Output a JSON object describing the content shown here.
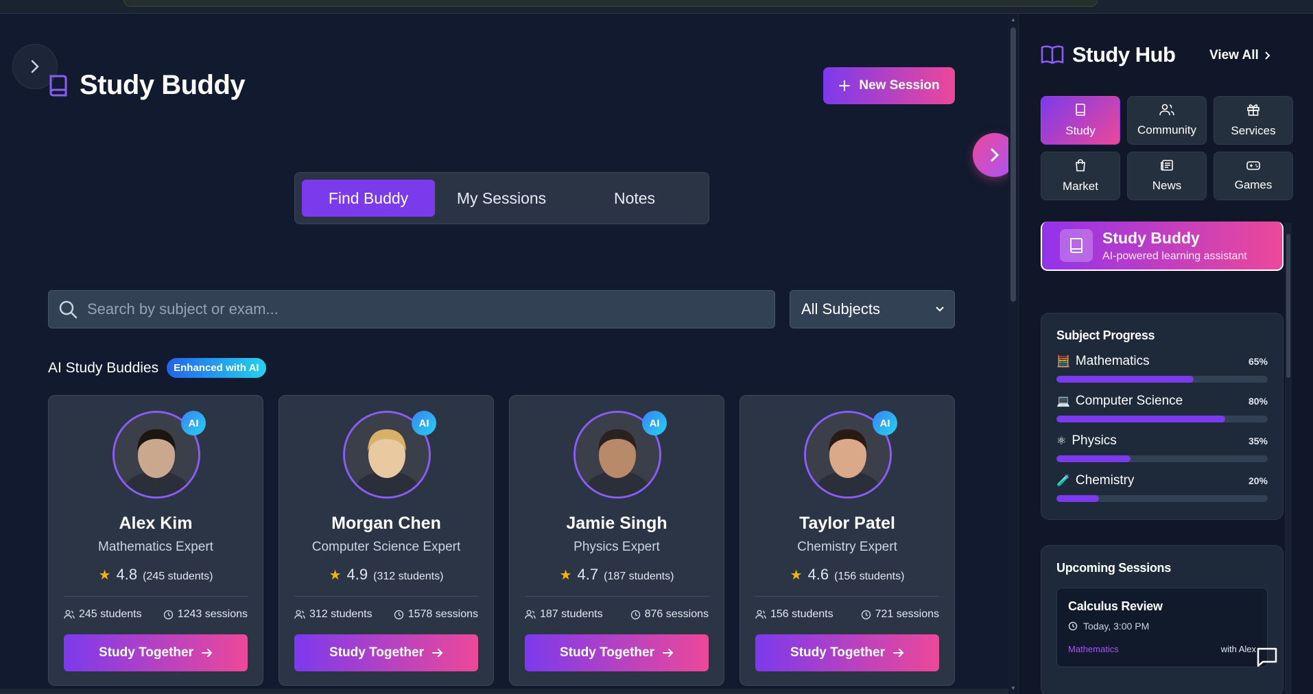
{
  "app": {
    "title": "Study Buddy",
    "new_session_label": "New Session"
  },
  "tabs": [
    {
      "label": "Find Buddy",
      "active": true
    },
    {
      "label": "My Sessions",
      "active": false
    },
    {
      "label": "Notes",
      "active": false
    }
  ],
  "search": {
    "placeholder": "Search by subject or exam...",
    "value": ""
  },
  "filter": {
    "selected": "All Subjects"
  },
  "section": {
    "title": "AI Study Buddies",
    "badge": "Enhanced with AI"
  },
  "buddies": [
    {
      "name": "Alex Kim",
      "role": "Mathematics Expert",
      "rating": "4.8",
      "rating_count": "(245 students)",
      "students": "245 students",
      "sessions": "1243 sessions",
      "ai": "AI",
      "cta": "Study Together",
      "avatar_bg": "#c9a88e",
      "hair": "#1c1510"
    },
    {
      "name": "Morgan Chen",
      "role": "Computer Science Expert",
      "rating": "4.9",
      "rating_count": "(312 students)",
      "students": "312 students",
      "sessions": "1578 sessions",
      "ai": "AI",
      "cta": "Study Together",
      "avatar_bg": "#e8c9a0",
      "hair": "#d8b068"
    },
    {
      "name": "Jamie Singh",
      "role": "Physics Expert",
      "rating": "4.7",
      "rating_count": "(187 students)",
      "students": "187 students",
      "sessions": "876 sessions",
      "ai": "AI",
      "cta": "Study Together",
      "avatar_bg": "#b98a6a",
      "hair": "#2a2220"
    },
    {
      "name": "Taylor Patel",
      "role": "Chemistry Expert",
      "rating": "4.6",
      "rating_count": "(156 students)",
      "students": "156 students",
      "sessions": "721 sessions",
      "ai": "AI",
      "cta": "Study Together",
      "avatar_bg": "#d9a98a",
      "hair": "#2a1a14"
    }
  ],
  "sidebar": {
    "title": "Study Hub",
    "view_all": "View All",
    "tiles": [
      {
        "label": "Study",
        "icon": "book-icon",
        "active": true
      },
      {
        "label": "Community",
        "icon": "users-icon",
        "active": false
      },
      {
        "label": "Services",
        "icon": "gift-icon",
        "active": false
      },
      {
        "label": "Market",
        "icon": "shopping-bag-icon",
        "active": false
      },
      {
        "label": "News",
        "icon": "newspaper-icon",
        "active": false
      },
      {
        "label": "Games",
        "icon": "gamepad-icon",
        "active": false
      }
    ],
    "featured": {
      "title": "Study Buddy",
      "subtitle": "AI-powered learning assistant"
    },
    "progress": {
      "title": "Subject Progress",
      "items": [
        {
          "name": "Mathematics",
          "pct_label": "65%",
          "value": 0.65,
          "emoji": "🧮"
        },
        {
          "name": "Computer Science",
          "pct_label": "80%",
          "value": 0.8,
          "emoji": "💻"
        },
        {
          "name": "Physics",
          "pct_label": "35%",
          "value": 0.35,
          "emoji": "⚛"
        },
        {
          "name": "Chemistry",
          "pct_label": "20%",
          "value": 0.2,
          "emoji": "🧪"
        }
      ]
    },
    "sessions": {
      "title": "Upcoming Sessions",
      "items": [
        {
          "title": "Calculus Review",
          "time": "Today, 3:00 PM",
          "subject": "Mathematics",
          "with": "with Alex"
        }
      ]
    }
  },
  "colors": {
    "accent_purple": "#7c3aed",
    "accent_pink": "#ec4899",
    "background": "#111a2e",
    "card": "#2b3546",
    "star": "#f5b400"
  }
}
